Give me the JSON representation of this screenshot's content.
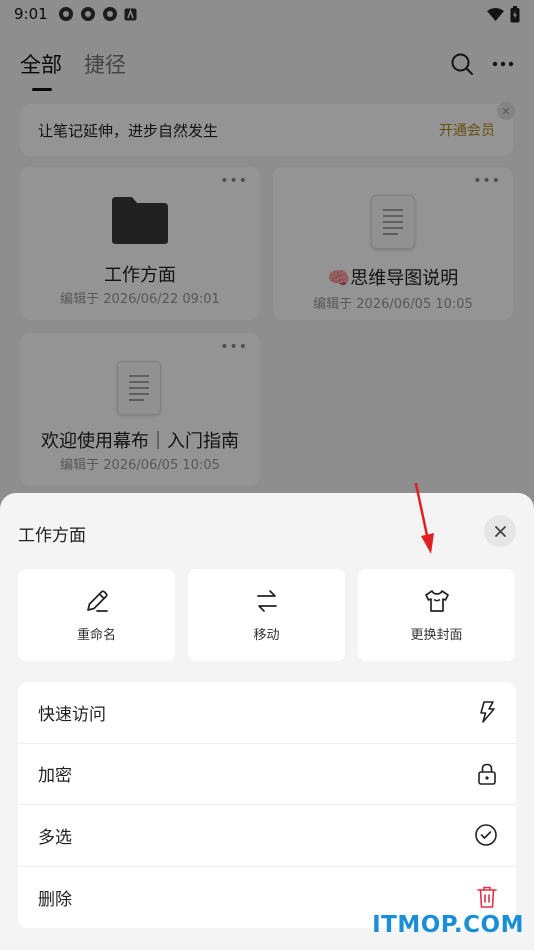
{
  "status_bar": {
    "time": "9:01"
  },
  "header": {
    "tabs": [
      {
        "label": "全部",
        "active": true
      },
      {
        "label": "捷径",
        "active": false
      }
    ]
  },
  "promo": {
    "text": "让笔记延伸，进步自然发生",
    "link": "开通会员"
  },
  "cards": [
    {
      "type": "folder",
      "title": "工作方面",
      "date": "编辑于 2026/06/22 09:01"
    },
    {
      "type": "document",
      "title": "🧠思维导图说明",
      "date": "编辑于 2026/06/05 10:05"
    },
    {
      "type": "document",
      "title": "欢迎使用幕布｜入门指南",
      "date": "编辑于 2026/06/05 10:05"
    }
  ],
  "sheet": {
    "title": "工作方面",
    "actions": [
      {
        "label": "重命名",
        "icon": "pencil-icon"
      },
      {
        "label": "移动",
        "icon": "swap-arrows-icon"
      },
      {
        "label": "更换封面",
        "icon": "shirt-icon"
      }
    ],
    "menu": [
      {
        "label": "快速访问",
        "icon": "lightning-icon"
      },
      {
        "label": "加密",
        "icon": "lock-icon"
      },
      {
        "label": "多选",
        "icon": "check-circle-icon"
      },
      {
        "label": "删除",
        "icon": "trash-icon",
        "color": "#e0314b"
      }
    ]
  },
  "annotation": {
    "color": "#e02020"
  },
  "watermark": "ITMOP.COM"
}
